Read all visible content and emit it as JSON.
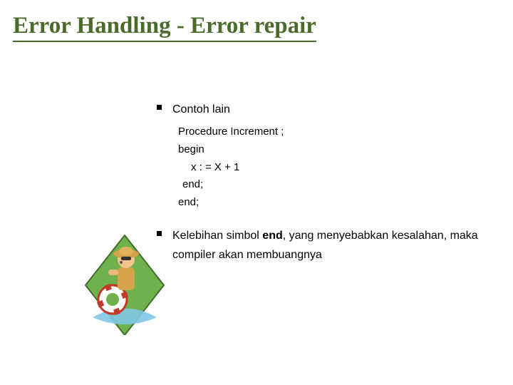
{
  "title": "Error Handling - Error repair",
  "bullet1": "Contoh  lain",
  "code": {
    "l1": "Procedure Increment ;",
    "l2": "begin",
    "l3": "x : = X + 1",
    "l4": "end;",
    "l5": "end;"
  },
  "bullet2_pre": "Kelebihan simbol ",
  "bullet2_bold": "end",
  "bullet2_post": ", yang menyebabkan kesalahan, maka compiler akan membuangnya",
  "illust_alt": "lifeguard-cartoon"
}
